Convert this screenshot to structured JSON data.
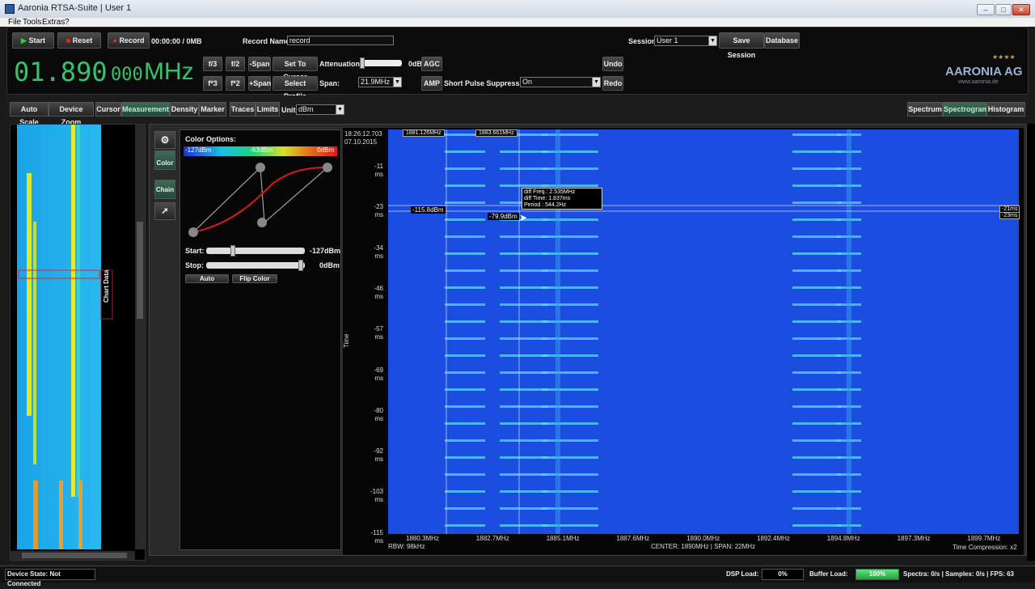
{
  "window": {
    "title": "Aaronia RTSA-Suite | User 1"
  },
  "menu": [
    "File",
    "Tools",
    "Extras",
    "?"
  ],
  "toolbar": {
    "start": "Start",
    "reset": "Reset",
    "record": "Record",
    "record_status": "00:00:00 / 0MB",
    "record_name_label": "Record Name:",
    "record_name_value": "record",
    "session_label": "Session:",
    "session_value": "User 1",
    "save_session": "Save Session",
    "database": "Database",
    "freq_main": "01.890",
    "freq_sub": "000",
    "freq_unit": "MHz",
    "f_div3": "f/3",
    "f_div2": "f/2",
    "minus_span": "-Span",
    "set_to_cursor": "Set To Cursor",
    "f_mul3": "f*3",
    "f_mul2": "f*2",
    "plus_span": "+Span",
    "select_profile": "Select Profile",
    "attenuation_label": "Attenuation:",
    "attenuation_value": "0dB",
    "agc": "AGC",
    "amp": "AMP",
    "span_label": "Span:",
    "span_value": "21.9MHz",
    "short_pulse_label": "Short Pulse Suppression:",
    "short_pulse_value": "On",
    "undo": "Undo",
    "redo": "Redo",
    "logo": "AARONIA AG",
    "logo_url": "www.aaronia.de"
  },
  "tabs": {
    "auto_scale": "Auto Scale",
    "device_zoom": "Device Zoom",
    "cursor": "Cursor",
    "measurement": "Measurement",
    "density": "Density",
    "marker": "Marker",
    "traces": "Traces",
    "limits": "Limits",
    "unit_label": "Unit:",
    "unit_value": "dBm",
    "spectrum": "Spectrum",
    "spectrogram": "Spectrogram",
    "histogram": "Histogram"
  },
  "left": {
    "chart_data_label": "Chart Data"
  },
  "side_buttons": {
    "color": "Color",
    "chain": "Chain"
  },
  "color_options": {
    "title": "Color Options:",
    "low": "-127dBm",
    "mid": "-63dBm",
    "high": "0dBm",
    "start_label": "Start:",
    "start_value": "-127dBm",
    "stop_label": "Stop:",
    "stop_value": "0dBm",
    "auto": "Auto",
    "flip": "Flip Color"
  },
  "spectrogram": {
    "timestamp": "18:26:12.703",
    "date": "07.10.2015",
    "y_axis_label": "Time",
    "y_ticks": [
      "-11",
      "-23",
      "-34",
      "-46",
      "-57",
      "-69",
      "-80",
      "-92",
      "-103",
      "-115"
    ],
    "y_unit": "ms",
    "x_ticks": [
      "1880.3MHz",
      "1882.7MHz",
      "1885.1MHz",
      "1887.6MHz",
      "1890.0MHz",
      "1892.4MHz",
      "1894.8MHz",
      "1897.3MHz",
      "1899.7MHz"
    ],
    "rbw": "RBW: 98kHz",
    "center_span": "CENTER: 1890MHz | SPAN: 22MHz",
    "time_compression": "Time Compression: x2",
    "marker1": "1881.126MHz",
    "marker2": "1883.661MHz",
    "level1": "-115.8dBm",
    "level2": "-79.9dBm",
    "tooltip_freq": "diff Freq.: 2.535MHz",
    "tooltip_time": "diff Time: 1.837ms",
    "tooltip_period": "Period    : 544.2Hz",
    "right_mark1": "-21ms",
    "right_mark2": "-23ms"
  },
  "status": {
    "device_state": "Device State: Not Connected",
    "dsp_label": "DSP Load:",
    "dsp_value": "0%",
    "buffer_label": "Buffer Load:",
    "buffer_value": "100%",
    "buffer_fill": 1.0,
    "stats": "Spectra: 0/s | Samples: 0/s | FPS: 63"
  },
  "colors": {
    "accent_green": "#35c46a",
    "spectro_bg": "#1a4de0",
    "active_tab": "#2f5a47"
  }
}
